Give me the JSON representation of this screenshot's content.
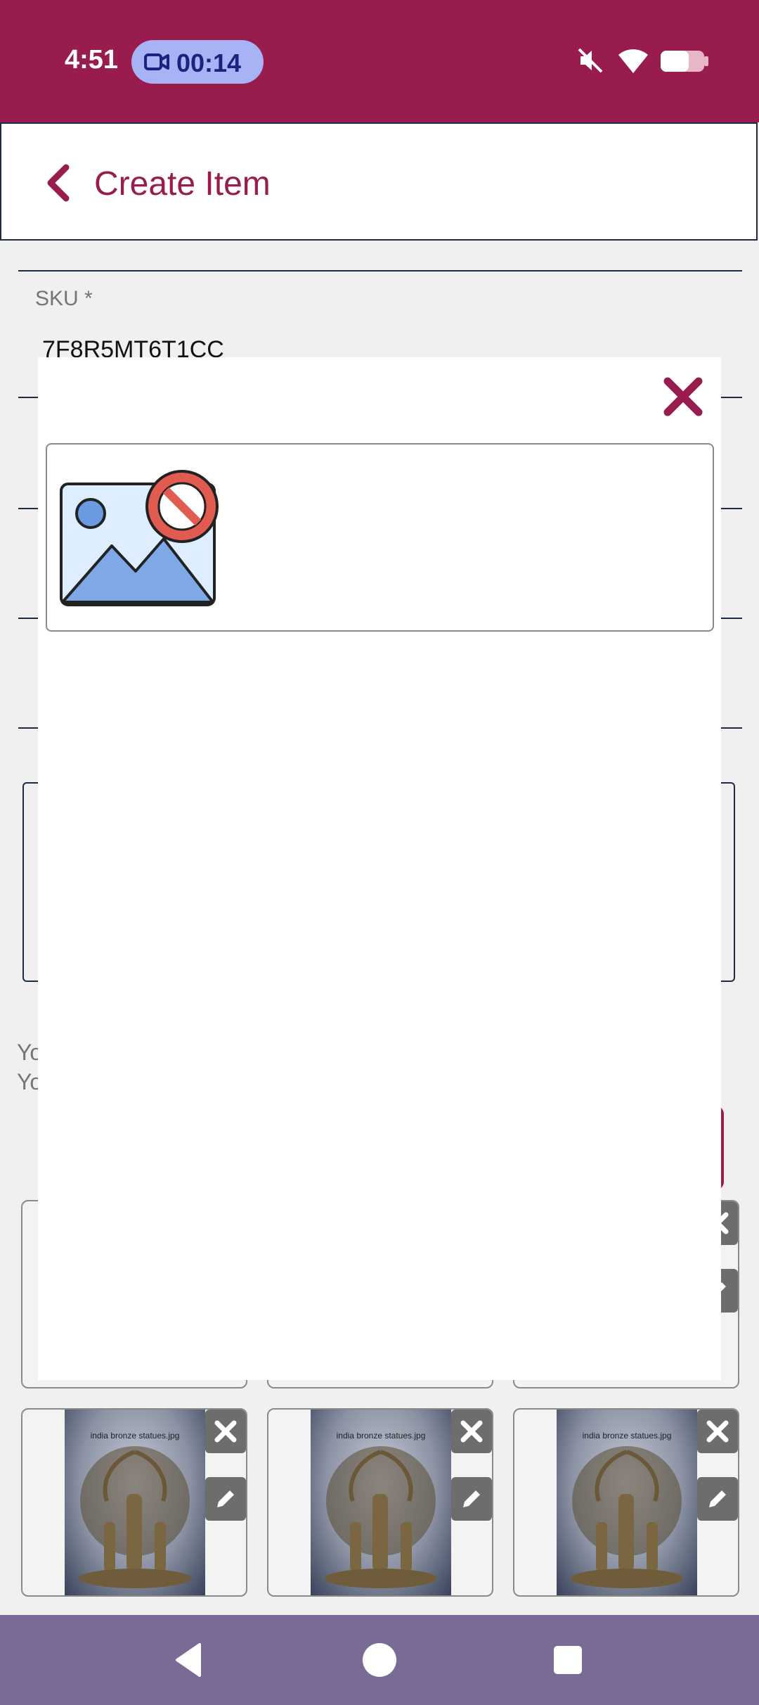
{
  "status_bar": {
    "time": "4:51",
    "recording_timer": "00:14",
    "icons": [
      "video-camera-icon",
      "mute-icon",
      "wifi-icon",
      "battery-icon"
    ]
  },
  "header": {
    "title": "Create Item",
    "back_icon": "chevron-left-icon"
  },
  "form": {
    "sku_label": "SKU *",
    "sku_value": "7F8R5MT6T1CC",
    "hint_line_1": "Yo",
    "hint_line_2": "Yo"
  },
  "photos": {
    "caption": "india bronze statues.jpg",
    "delete_icon": "close-icon",
    "edit_icon": "pencil-icon"
  },
  "modal": {
    "close_icon": "close-icon",
    "placeholder_icon": "broken-image-icon"
  },
  "nav_bar": {
    "icons": [
      "back-triangle-icon",
      "home-circle-icon",
      "recents-square-icon"
    ]
  },
  "colors": {
    "brand": "#991c4f",
    "nav_bar": "#7a6a96",
    "recording_pill": "#a8b3f5"
  }
}
